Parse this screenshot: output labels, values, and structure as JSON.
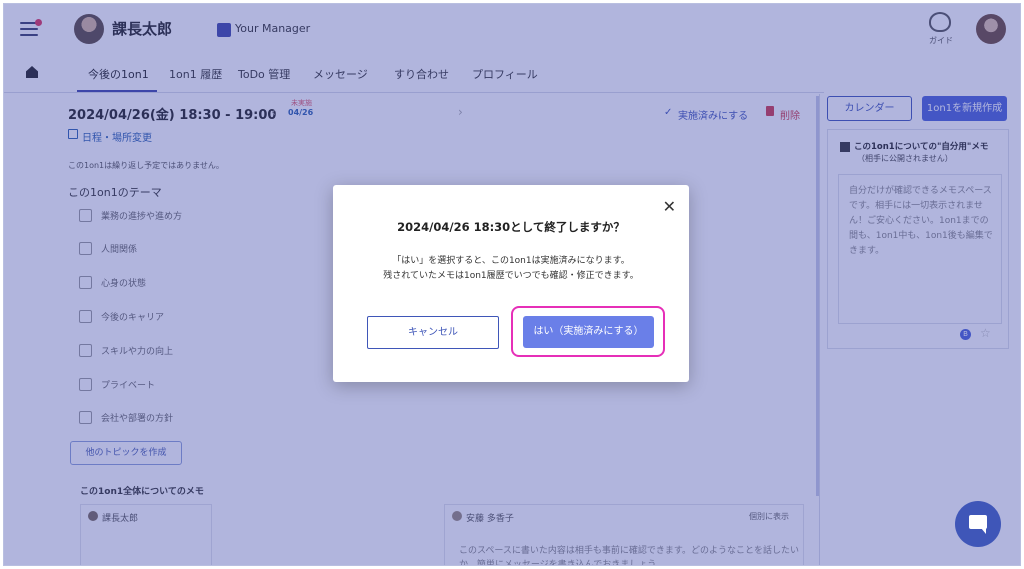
{
  "header": {
    "user_name": "課長太郎",
    "manager_label": "Your Manager",
    "guide_label": "ガイド"
  },
  "tabs": [
    {
      "label": "今後の1on1"
    },
    {
      "label": "1on1 履歴"
    },
    {
      "label": "ToDo 管理"
    },
    {
      "label": "メッセージ"
    },
    {
      "label": "すり合わせ"
    },
    {
      "label": "プロフィール"
    }
  ],
  "meeting": {
    "date_time": "2024/04/26(金)  18:30 - 19:00",
    "status_label": "未実施",
    "short_date": "04/26",
    "done_link": "実施済みにする",
    "delete_link": "削除",
    "schedule_link": "日程・場所変更",
    "repeat_note": "この1on1は繰り返し予定ではありません。"
  },
  "themes": {
    "title": "この1on1のテーマ",
    "items": [
      {
        "label": "業務の進捗や進め方"
      },
      {
        "label": "人間関係"
      },
      {
        "label": "心身の状態"
      },
      {
        "label": "今後のキャリア"
      },
      {
        "label": "スキルや力の向上"
      },
      {
        "label": "プライベート"
      },
      {
        "label": "会社や部署の方針"
      }
    ],
    "add_topic": "他のトピックを作成"
  },
  "memo": {
    "title": "この1on1全体についてのメモ",
    "author1": "課長太郎",
    "author2": "安藤 多香子",
    "private_label": "個別に表示",
    "body": "このスペースに書いた内容は相手も事前に確認できます。どのようなことを話したいか、簡単にメッセージを書き込んでおきましょう。"
  },
  "right_panel": {
    "calendar_button": "カレンダー",
    "new_button": "1on1を新規作成",
    "self_memo_title": "この1on1についての\"自分用\"メモ",
    "self_memo_sub": "（相手に公開されません）",
    "self_memo_text": "自分だけが確認できるメモスペースです。相手には一切表示されません！ご安心ください。1on1までの間も、1on1中も、1on1後も編集できます。",
    "badge": "B"
  },
  "modal": {
    "title": "2024/04/26 18:30として終了しますか？",
    "line1": "「はい」を選択すると、この1on1は実施済みになります。",
    "line2": "残されていたメモは1on1履歴でいつでも確認・修正できます。",
    "cancel_label": "キャンセル",
    "confirm_label": "はい（実施済みにする）"
  },
  "colors": {
    "accent": "#3f56b8",
    "confirm": "#6a7fe8",
    "highlight": "#e62fb8",
    "danger": "#d03a4a"
  }
}
